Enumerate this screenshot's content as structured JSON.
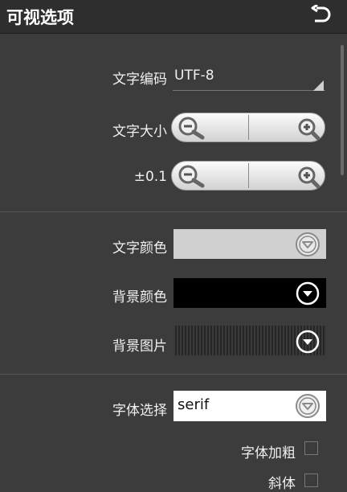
{
  "header": {
    "title": "可视选项",
    "back_icon": "back-arrow-icon"
  },
  "encoding": {
    "label": "文字编码",
    "value": "UTF-8"
  },
  "font_size": {
    "label": "文字大小"
  },
  "fine_step": {
    "label": "±0.1"
  },
  "text_color": {
    "label": "文字颜色",
    "value_color": "#d0d0d0"
  },
  "bg_color": {
    "label": "背景颜色",
    "value_color": "#000000"
  },
  "bg_image": {
    "label": "背景图片"
  },
  "font_choice": {
    "label": "字体选择",
    "value": "serif"
  },
  "bold": {
    "label": "字体加粗",
    "checked": false
  },
  "italic": {
    "label": "斜体",
    "checked": false
  },
  "icons": [
    "back-arrow-icon",
    "dropdown-triangle-icon",
    "zoom-out-icon",
    "zoom-in-icon",
    "chevron-down-circle-icon"
  ]
}
